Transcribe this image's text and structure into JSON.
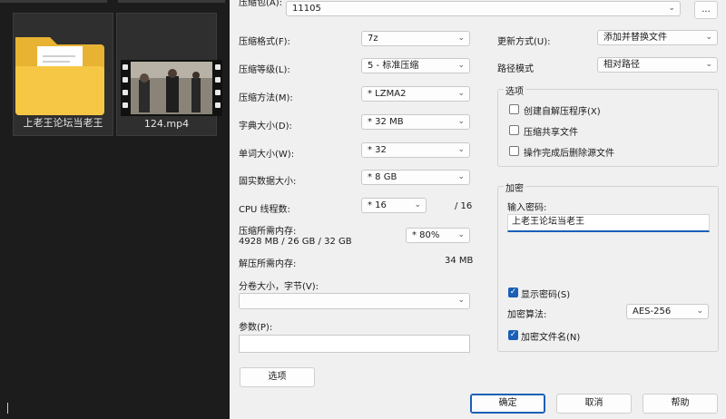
{
  "explorer": {
    "items": [
      {
        "name": "上老王论坛当老王",
        "kind": "folder"
      },
      {
        "name": "124.mp4",
        "kind": "video"
      }
    ]
  },
  "dialog": {
    "archive_label": "压缩包(A):",
    "archive_value": "11105",
    "browse_label": "...",
    "format_label": "压缩格式(F):",
    "format_value": "7z",
    "level_label": "压缩等级(L):",
    "level_value": "5 - 标准压缩",
    "method_label": "压缩方法(M):",
    "method_value": "* LZMA2",
    "dict_label": "字典大小(D):",
    "dict_value": "* 32 MB",
    "word_label": "单词大小(W):",
    "word_value": "* 32",
    "solid_label": "固实数据大小:",
    "solid_value": "* 8 GB",
    "threads_label": "CPU 线程数:",
    "threads_value": "* 16",
    "threads_total": "/ 16",
    "mem_comp_label": "压缩所需内存:",
    "mem_comp_detail": "4928 MB / 26 GB / 32 GB",
    "mem_comp_value": "* 80%",
    "mem_decomp_label": "解压所需内存:",
    "mem_decomp_value": "34 MB",
    "split_label": "分卷大小，字节(V):",
    "split_value": "",
    "params_label": "参数(P):",
    "params_value": "",
    "options_button": "选项",
    "update_label": "更新方式(U):",
    "update_value": "添加并替换文件",
    "path_label": "路径模式",
    "path_value": "相对路径",
    "options_group": "选项",
    "opt_sfx": "创建自解压程序(X)",
    "opt_shared": "压缩共享文件",
    "opt_delete": "操作完成后删除源文件",
    "encryption_group": "加密",
    "password_label": "输入密码:",
    "password_value": "上老王论坛当老王",
    "show_password": "显示密码(S)",
    "enc_method_label": "加密算法:",
    "enc_method_value": "AES-256",
    "encrypt_names": "加密文件名(N)",
    "ok": "确定",
    "cancel": "取消",
    "help": "帮助"
  }
}
